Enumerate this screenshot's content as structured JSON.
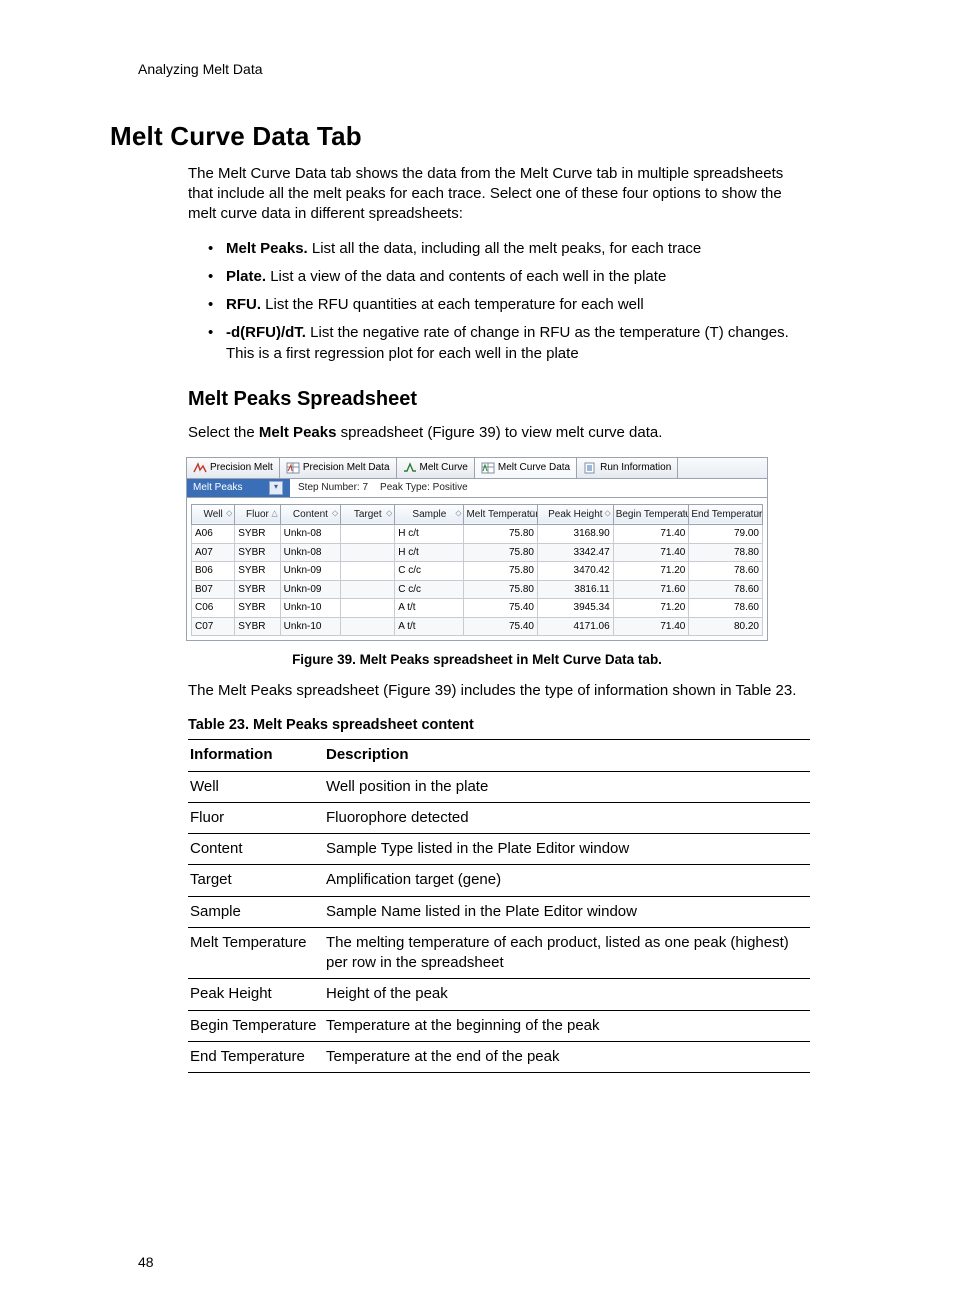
{
  "header": "Analyzing Melt Data",
  "title": "Melt Curve Data Tab",
  "intro": "The Melt Curve Data tab shows the data from the Melt Curve tab in multiple spreadsheets that include all the melt peaks for each trace. Select one of these four options to show the melt curve data in different spreadsheets:",
  "bullets": [
    {
      "term": "Melt Peaks.",
      "rest": " List all the data, including all the melt peaks, for each trace"
    },
    {
      "term": "Plate.",
      "rest": " List a view of the data and contents of each well in the plate"
    },
    {
      "term": "RFU.",
      "rest": " List the RFU quantities at each temperature for each well"
    },
    {
      "term": "-d(RFU)/dT.",
      "rest": " List the negative rate of change in RFU as the temperature (T) changes. This is a first regression plot for each well in the plate"
    }
  ],
  "subTitle": "Melt Peaks Spreadsheet",
  "subIntroPre": "Select the ",
  "subIntroBold": "Melt Peaks",
  "subIntroPost": " spreadsheet (Figure 39) to view melt curve data.",
  "app": {
    "tabs": [
      "Precision Melt",
      "Precision Melt Data",
      "Melt Curve",
      "Melt Curve Data",
      "Run Information"
    ],
    "dropdown": "Melt Peaks",
    "stepNumber": "Step Number:  7",
    "peakType": "Peak Type:  Positive",
    "headers": [
      "Well",
      "Fluor",
      "Content",
      "Target",
      "Sample",
      "Melt Temperature",
      "Peak Height",
      "Begin Temperature",
      "End Temperature"
    ],
    "sortGlyphs": [
      "◇",
      "△",
      "◇",
      "◇",
      "◇",
      "◇",
      "◇",
      "◇",
      "◇"
    ],
    "rows": [
      {
        "well": "A06",
        "fluor": "SYBR",
        "content": "Unkn-08",
        "target": "",
        "sample": "H c/t",
        "mt": "75.80",
        "ph": "3168.90",
        "bt": "71.40",
        "et": "79.00"
      },
      {
        "well": "A07",
        "fluor": "SYBR",
        "content": "Unkn-08",
        "target": "",
        "sample": "H c/t",
        "mt": "75.80",
        "ph": "3342.47",
        "bt": "71.40",
        "et": "78.80"
      },
      {
        "well": "B06",
        "fluor": "SYBR",
        "content": "Unkn-09",
        "target": "",
        "sample": "C c/c",
        "mt": "75.80",
        "ph": "3470.42",
        "bt": "71.20",
        "et": "78.60"
      },
      {
        "well": "B07",
        "fluor": "SYBR",
        "content": "Unkn-09",
        "target": "",
        "sample": "C c/c",
        "mt": "75.80",
        "ph": "3816.11",
        "bt": "71.60",
        "et": "78.60"
      },
      {
        "well": "C06",
        "fluor": "SYBR",
        "content": "Unkn-10",
        "target": "",
        "sample": "A t/t",
        "mt": "75.40",
        "ph": "3945.34",
        "bt": "71.20",
        "et": "78.60"
      },
      {
        "well": "C07",
        "fluor": "SYBR",
        "content": "Unkn-10",
        "target": "",
        "sample": "A t/t",
        "mt": "75.40",
        "ph": "4171.06",
        "bt": "71.40",
        "et": "80.20"
      }
    ]
  },
  "figureCaption": "Figure 39. Melt Peaks spreadsheet in Melt Curve Data tab.",
  "afterFigure": "The Melt Peaks spreadsheet (Figure 39) includes the type of information shown in Table 23.",
  "tableCaption": "Table 23.  Melt Peaks spreadsheet content",
  "descHeaders": {
    "info": "Information",
    "desc": "Description"
  },
  "descRows": [
    {
      "info": "Well",
      "desc": "Well position in the plate"
    },
    {
      "info": "Fluor",
      "desc": "Fluorophore detected"
    },
    {
      "info": "Content",
      "desc": "Sample Type listed in the Plate Editor window"
    },
    {
      "info": "Target",
      "desc": "Amplification target (gene)"
    },
    {
      "info": "Sample",
      "desc": "Sample Name listed in the Plate Editor window"
    },
    {
      "info": "Melt Temperature",
      "desc": "The melting temperature of each product, listed as one peak (highest) per row in the spreadsheet"
    },
    {
      "info": "Peak Height",
      "desc": "Height of the peak"
    },
    {
      "info": "Begin Temperature",
      "desc": "Temperature at the beginning of the peak"
    },
    {
      "info": "End Temperature",
      "desc": "Temperature at the end of the peak"
    }
  ],
  "pageNumber": "48",
  "chart_data": {
    "type": "table",
    "title": "Melt Peaks",
    "columns": [
      "Well",
      "Fluor",
      "Content",
      "Target",
      "Sample",
      "Melt Temperature",
      "Peak Height",
      "Begin Temperature",
      "End Temperature"
    ],
    "rows": [
      [
        "A06",
        "SYBR",
        "Unkn-08",
        "",
        "H c/t",
        75.8,
        3168.9,
        71.4,
        79.0
      ],
      [
        "A07",
        "SYBR",
        "Unkn-08",
        "",
        "H c/t",
        75.8,
        3342.47,
        71.4,
        78.8
      ],
      [
        "B06",
        "SYBR",
        "Unkn-09",
        "",
        "C c/c",
        75.8,
        3470.42,
        71.2,
        78.6
      ],
      [
        "B07",
        "SYBR",
        "Unkn-09",
        "",
        "C c/c",
        75.8,
        3816.11,
        71.6,
        78.6
      ],
      [
        "C06",
        "SYBR",
        "Unkn-10",
        "",
        "A t/t",
        75.4,
        3945.34,
        71.2,
        78.6
      ],
      [
        "C07",
        "SYBR",
        "Unkn-10",
        "",
        "A t/t",
        75.4,
        4171.06,
        71.4,
        80.2
      ]
    ]
  }
}
